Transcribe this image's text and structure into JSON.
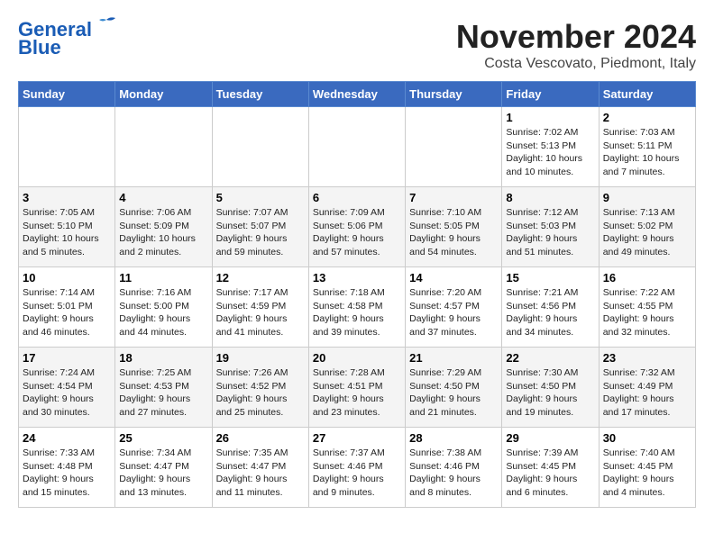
{
  "header": {
    "logo_line1": "General",
    "logo_line2": "Blue",
    "month": "November 2024",
    "location": "Costa Vescovato, Piedmont, Italy"
  },
  "weekdays": [
    "Sunday",
    "Monday",
    "Tuesday",
    "Wednesday",
    "Thursday",
    "Friday",
    "Saturday"
  ],
  "weeks": [
    [
      {
        "day": "",
        "info": ""
      },
      {
        "day": "",
        "info": ""
      },
      {
        "day": "",
        "info": ""
      },
      {
        "day": "",
        "info": ""
      },
      {
        "day": "",
        "info": ""
      },
      {
        "day": "1",
        "info": "Sunrise: 7:02 AM\nSunset: 5:13 PM\nDaylight: 10 hours\nand 10 minutes."
      },
      {
        "day": "2",
        "info": "Sunrise: 7:03 AM\nSunset: 5:11 PM\nDaylight: 10 hours\nand 7 minutes."
      }
    ],
    [
      {
        "day": "3",
        "info": "Sunrise: 7:05 AM\nSunset: 5:10 PM\nDaylight: 10 hours\nand 5 minutes."
      },
      {
        "day": "4",
        "info": "Sunrise: 7:06 AM\nSunset: 5:09 PM\nDaylight: 10 hours\nand 2 minutes."
      },
      {
        "day": "5",
        "info": "Sunrise: 7:07 AM\nSunset: 5:07 PM\nDaylight: 9 hours\nand 59 minutes."
      },
      {
        "day": "6",
        "info": "Sunrise: 7:09 AM\nSunset: 5:06 PM\nDaylight: 9 hours\nand 57 minutes."
      },
      {
        "day": "7",
        "info": "Sunrise: 7:10 AM\nSunset: 5:05 PM\nDaylight: 9 hours\nand 54 minutes."
      },
      {
        "day": "8",
        "info": "Sunrise: 7:12 AM\nSunset: 5:03 PM\nDaylight: 9 hours\nand 51 minutes."
      },
      {
        "day": "9",
        "info": "Sunrise: 7:13 AM\nSunset: 5:02 PM\nDaylight: 9 hours\nand 49 minutes."
      }
    ],
    [
      {
        "day": "10",
        "info": "Sunrise: 7:14 AM\nSunset: 5:01 PM\nDaylight: 9 hours\nand 46 minutes."
      },
      {
        "day": "11",
        "info": "Sunrise: 7:16 AM\nSunset: 5:00 PM\nDaylight: 9 hours\nand 44 minutes."
      },
      {
        "day": "12",
        "info": "Sunrise: 7:17 AM\nSunset: 4:59 PM\nDaylight: 9 hours\nand 41 minutes."
      },
      {
        "day": "13",
        "info": "Sunrise: 7:18 AM\nSunset: 4:58 PM\nDaylight: 9 hours\nand 39 minutes."
      },
      {
        "day": "14",
        "info": "Sunrise: 7:20 AM\nSunset: 4:57 PM\nDaylight: 9 hours\nand 37 minutes."
      },
      {
        "day": "15",
        "info": "Sunrise: 7:21 AM\nSunset: 4:56 PM\nDaylight: 9 hours\nand 34 minutes."
      },
      {
        "day": "16",
        "info": "Sunrise: 7:22 AM\nSunset: 4:55 PM\nDaylight: 9 hours\nand 32 minutes."
      }
    ],
    [
      {
        "day": "17",
        "info": "Sunrise: 7:24 AM\nSunset: 4:54 PM\nDaylight: 9 hours\nand 30 minutes."
      },
      {
        "day": "18",
        "info": "Sunrise: 7:25 AM\nSunset: 4:53 PM\nDaylight: 9 hours\nand 27 minutes."
      },
      {
        "day": "19",
        "info": "Sunrise: 7:26 AM\nSunset: 4:52 PM\nDaylight: 9 hours\nand 25 minutes."
      },
      {
        "day": "20",
        "info": "Sunrise: 7:28 AM\nSunset: 4:51 PM\nDaylight: 9 hours\nand 23 minutes."
      },
      {
        "day": "21",
        "info": "Sunrise: 7:29 AM\nSunset: 4:50 PM\nDaylight: 9 hours\nand 21 minutes."
      },
      {
        "day": "22",
        "info": "Sunrise: 7:30 AM\nSunset: 4:50 PM\nDaylight: 9 hours\nand 19 minutes."
      },
      {
        "day": "23",
        "info": "Sunrise: 7:32 AM\nSunset: 4:49 PM\nDaylight: 9 hours\nand 17 minutes."
      }
    ],
    [
      {
        "day": "24",
        "info": "Sunrise: 7:33 AM\nSunset: 4:48 PM\nDaylight: 9 hours\nand 15 minutes."
      },
      {
        "day": "25",
        "info": "Sunrise: 7:34 AM\nSunset: 4:47 PM\nDaylight: 9 hours\nand 13 minutes."
      },
      {
        "day": "26",
        "info": "Sunrise: 7:35 AM\nSunset: 4:47 PM\nDaylight: 9 hours\nand 11 minutes."
      },
      {
        "day": "27",
        "info": "Sunrise: 7:37 AM\nSunset: 4:46 PM\nDaylight: 9 hours\nand 9 minutes."
      },
      {
        "day": "28",
        "info": "Sunrise: 7:38 AM\nSunset: 4:46 PM\nDaylight: 9 hours\nand 8 minutes."
      },
      {
        "day": "29",
        "info": "Sunrise: 7:39 AM\nSunset: 4:45 PM\nDaylight: 9 hours\nand 6 minutes."
      },
      {
        "day": "30",
        "info": "Sunrise: 7:40 AM\nSunset: 4:45 PM\nDaylight: 9 hours\nand 4 minutes."
      }
    ]
  ]
}
